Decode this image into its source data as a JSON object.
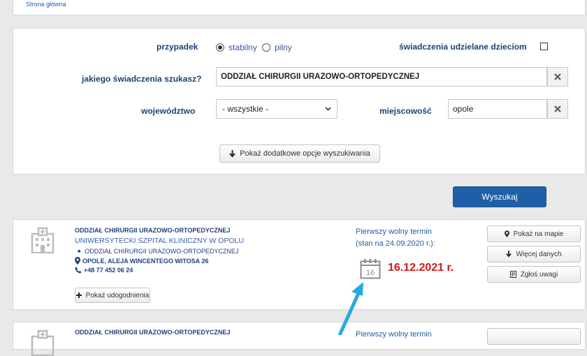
{
  "breadcrumb": {
    "home": "Strona główna"
  },
  "search": {
    "case_label": "przypadek",
    "case_options": [
      {
        "label": "stabilny",
        "checked": true
      },
      {
        "label": "pilny",
        "checked": false
      }
    ],
    "children_label": "świadczenia udzielane dzieciom",
    "children_checked": false,
    "service_label": "jakiego świadczenia szukasz?",
    "service_value": "ODDZIAŁ CHIRURGII URAZOWO-ORTOPEDYCZNEJ",
    "voivodeship_label": "województwo",
    "voivodeship_value": "- wszystkie -",
    "city_label": "miejscowość",
    "city_value": "opole",
    "more_options": "Pokaż dodatkowe opcje wyszukiwania",
    "submit": "Wyszukaj"
  },
  "results": [
    {
      "department": "ODDZIAŁ CHIRURGII URAZOWO-ORTOPEDYCZNEJ",
      "provider": "UNIWERSYTECKI SZPITAL KLINICZNY W OPOLU",
      "unit": "ODDZIAŁ CHIRURGII URAZOWO-ORTOPEDYCZNEJ",
      "address": "OPOLE, ALEJA WINCENTEGO WITOSA 26",
      "phone": "+48 77 452 06 24",
      "facilities_button": "Pokaż udogodnienia",
      "first_term_label": "Pierwszy wolny termin",
      "state_label": "(stan na 24.09.2020 r.):",
      "calendar_day": "16",
      "first_term_date": "16.12.2021 r.",
      "buttons": {
        "map": "Pokaż na mapie",
        "more": "Więcej danych",
        "report": "Zgłoś uwagi"
      }
    },
    {
      "department": "ODDZIAŁ CHIRURGII URAZOWO-ORTOPEDYCZNEJ",
      "first_term_label": "Pierwszy wolny termin"
    }
  ],
  "colors": {
    "accent": "#1f5fa8",
    "label": "#1f3f7a",
    "date": "#d11a1a",
    "arrow": "#27a9e1"
  }
}
